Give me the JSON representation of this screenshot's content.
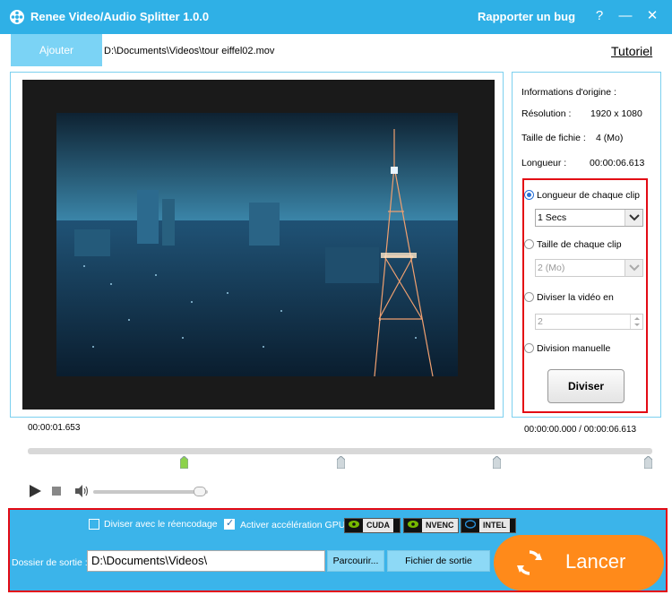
{
  "titlebar": {
    "title": "Renee Video/Audio Splitter 1.0.0",
    "bug_link": "Rapporter un bug",
    "help": "?",
    "minimize": "—",
    "close": "✕"
  },
  "toolbar": {
    "add_label": "Ajouter",
    "file_path": "D:\\Documents\\Videos\\tour eiffel02.mov",
    "tutorial": "Tutoriel"
  },
  "info": {
    "heading": "Informations d'origine :",
    "resolution_label": "Résolution :",
    "resolution_value": "1920 x 1080",
    "size_label": "Taille de fichie :",
    "size_value": "4 (Mo)",
    "length_label": "Longueur :",
    "length_value": "00:00:06.613"
  },
  "options": {
    "clip_length_label": "Longueur de chaque clip",
    "clip_length_value": "1 Secs",
    "clip_size_label": "Taille de chaque clip",
    "clip_size_value": "2 (Mo)",
    "divide_into_label": "Diviser la vidéo en",
    "divide_into_value": "2",
    "manual_label": "Division manuelle",
    "divide_button": "Diviser",
    "selected": "clip_length"
  },
  "player": {
    "current_time": "00:00:01.653",
    "range": "00:00:00.000 / 00:00:06.613",
    "volume_fraction": 0.93,
    "marker_fractions": [
      0.25,
      0.5,
      0.75,
      1.0
    ]
  },
  "output": {
    "reencode_label": "Diviser avec le réencodage",
    "reencode_checked": false,
    "gpu_label": "Activer accélération GPU",
    "gpu_checked": true,
    "gpu_badges": [
      "CUDA",
      "NVENC",
      "INTEL"
    ],
    "folder_label": "Dossier de sortie :",
    "folder_value": "D:\\Documents\\Videos\\",
    "browse": "Parcourir...",
    "open_folder": "Fichier de sortie",
    "launch": "Lancer"
  },
  "colors": {
    "accent": "#2fb0e6",
    "launch": "#ff8a1a",
    "highlight_border": "#e30a14"
  }
}
